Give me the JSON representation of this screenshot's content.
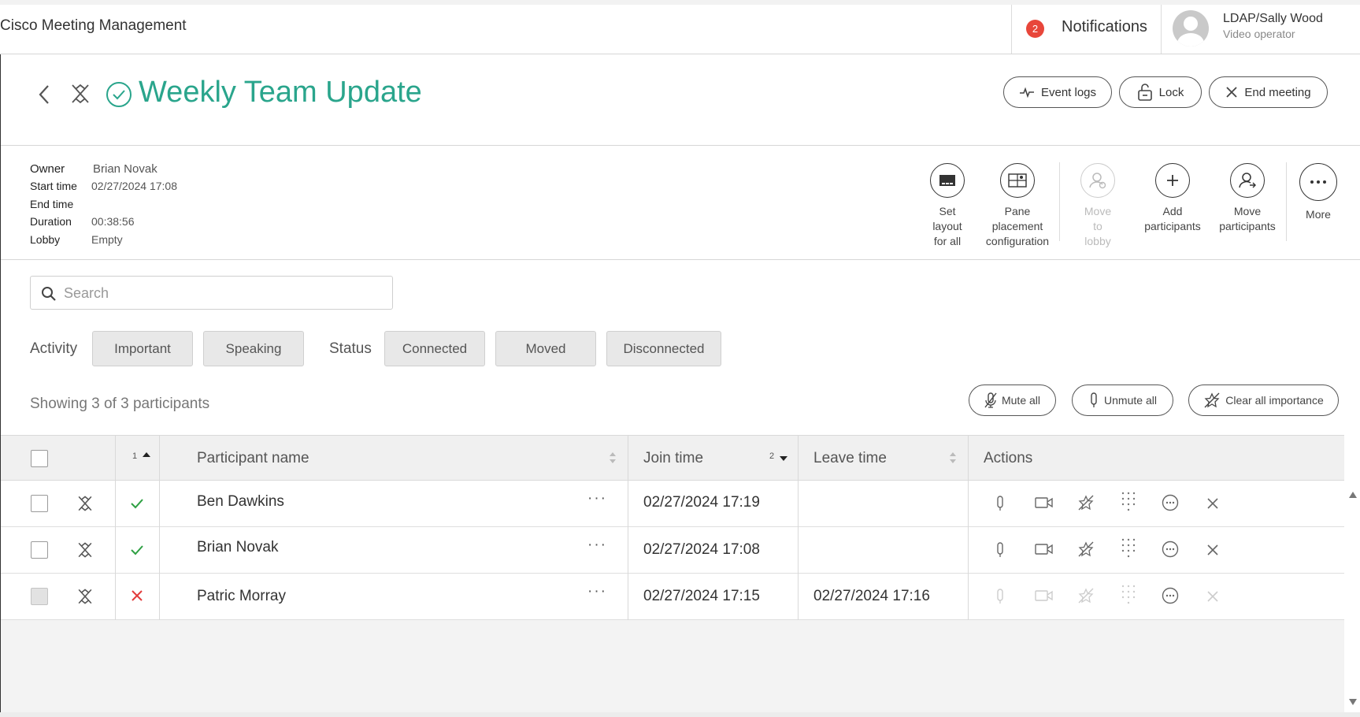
{
  "app": {
    "title": "Cisco Meeting Management"
  },
  "topbar": {
    "notification_count": "2",
    "notifications_label": "Notifications",
    "user_name": "LDAP/Sally Wood",
    "user_role": "Video operator"
  },
  "meeting": {
    "title": "Weekly Team Update",
    "buttons": {
      "event_logs": "Event logs",
      "lock": "Lock",
      "end_meeting": "End meeting"
    },
    "info": {
      "owner_label": "Owner",
      "owner": "Brian Novak",
      "start_label": "Start time",
      "start": "02/27/2024 17:08",
      "end_label": "End time",
      "end": "",
      "duration_label": "Duration",
      "duration": "00:38:56",
      "lobby_label": "Lobby",
      "lobby": "Empty"
    }
  },
  "toolbar": {
    "set_layout": [
      "Set",
      "layout",
      "for all"
    ],
    "pane_placement": [
      "Pane",
      "placement",
      "configuration"
    ],
    "move_to_lobby": [
      "Move",
      "to",
      "lobby"
    ],
    "add_participants": [
      "Add",
      "participants"
    ],
    "move_participants": [
      "Move",
      "participants"
    ],
    "more": [
      "More"
    ]
  },
  "search": {
    "placeholder": "Search",
    "value": ""
  },
  "filters": {
    "activity_label": "Activity",
    "activity": [
      "Important",
      "Speaking"
    ],
    "status_label": "Status",
    "status": [
      "Connected",
      "Moved",
      "Disconnected"
    ]
  },
  "participants_summary": "Showing 3 of 3 participants",
  "bulk_actions": {
    "mute_all": "Mute all",
    "unmute_all": "Unmute all",
    "clear_importance": "Clear all importance"
  },
  "table": {
    "sort_order_1": "1",
    "sort_order_2": "2",
    "headers": {
      "name": "Participant name",
      "join": "Join time",
      "leave": "Leave time",
      "actions": "Actions"
    },
    "rows": [
      {
        "name": "Ben Dawkins",
        "status": "connected",
        "join": "02/27/2024 17:19",
        "leave": "",
        "more": "···"
      },
      {
        "name": "Brian Novak",
        "status": "connected",
        "join": "02/27/2024 17:08",
        "leave": "",
        "more": "···"
      },
      {
        "name": "Patric Morray",
        "status": "disconnected",
        "join": "02/27/2024 17:15",
        "leave": "02/27/2024 17:16",
        "more": "···"
      }
    ]
  },
  "colors": {
    "accent": "#2aa58c",
    "badge": "#e8463a",
    "ok": "#2ea043",
    "error": "#e23b3b"
  },
  "icons": [
    "back-icon",
    "pin-icon",
    "check-circle-icon",
    "event-logs-icon",
    "lock-icon",
    "close-icon",
    "layout-icon",
    "pane-placement-icon",
    "move-to-lobby-icon",
    "plus-icon",
    "move-participants-icon",
    "more-icon",
    "search-icon",
    "mute-icon",
    "unmute-icon",
    "clear-importance-icon",
    "microphone-icon",
    "camera-icon",
    "importance-icon",
    "keypad-icon",
    "more-circle-icon"
  ]
}
